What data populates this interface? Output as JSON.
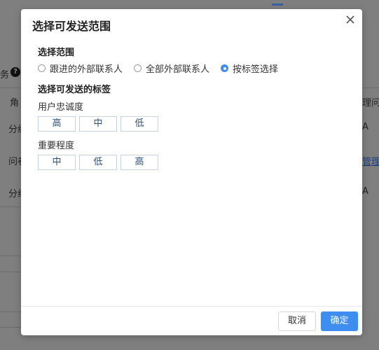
{
  "background": {
    "left_label": "务",
    "help_icon_glyph": "?",
    "col_header_left": "角",
    "col_header_right": "理问",
    "row1_left": "分组",
    "row1_right": "A",
    "row2_left": "问卷",
    "row2_right": "管理",
    "row3_left": "分组",
    "row3_right": "A"
  },
  "modal": {
    "title": "选择可发送范围",
    "scope_section_title": "选择范围",
    "scope_options": [
      {
        "label": "跟进的外部联系人",
        "checked": false
      },
      {
        "label": "全部外部联系人",
        "checked": false
      },
      {
        "label": "按标签选择",
        "checked": true
      }
    ],
    "tags_section_title": "选择可发送的标签",
    "tag_groups": [
      {
        "label": "用户忠诚度",
        "tags": [
          "高",
          "中",
          "低"
        ]
      },
      {
        "label": "重要程度",
        "tags": [
          "中",
          "低",
          "高"
        ]
      }
    ],
    "cancel_label": "取消",
    "confirm_label": "确定"
  },
  "colors": {
    "accent": "#3d8ef0",
    "tag_text": "#2a4e7c",
    "overlay": "#7f7f7f"
  }
}
